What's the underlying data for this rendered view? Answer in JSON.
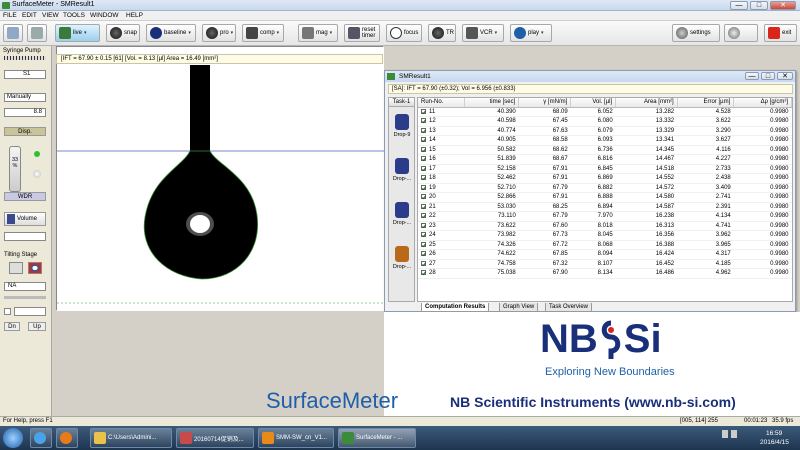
{
  "window": {
    "title": "SurfaceMeter - SMResult1",
    "min_label": "—",
    "max_label": "□",
    "close_label": "✕"
  },
  "menu": [
    "FILE",
    "EDIT",
    "VIEW",
    "TOOLS",
    "WINDOW",
    "HELP"
  ],
  "toolbar": {
    "live": "live",
    "snap": "snap",
    "baseline": "baseline",
    "pro": "pro",
    "comp": "comp",
    "mag": "mag",
    "reset_timer": "reset timer",
    "focus": "focus",
    "tr": "TR",
    "vcr": "VCR",
    "play": "play",
    "settings": "settings",
    "exit": "exit",
    "dropdown": "▾"
  },
  "left_panel": {
    "syringe_label": "Syringe Pump",
    "syringe_select": "S1",
    "mode_select": "Manually",
    "volume_value": "8.8",
    "dispense_label": "Disp.",
    "percent_value": "33",
    "percent_unit": "%",
    "wdr_label": "WDR",
    "volume_button": "Volume",
    "tilting_label": "Tilting Stage",
    "na_select": "NA",
    "dn_button": "Dn",
    "up_button": "Up"
  },
  "image": {
    "info": "[IFT = 67.90 ± 0.15 [61] [Vol. = 8.13 [µl]  Area = 16.49 [mm²]"
  },
  "result_window": {
    "title": "SMResult1",
    "formula": "[SA]: IFT = 67.90 (±0.32); Vol = 6.956 (±0.833)",
    "task_header": "Task-1",
    "tasks": [
      "Drop-9",
      "Drop-...",
      "Drop-..."
    ],
    "columns": [
      "Run-No.",
      "time [sec]",
      "γ [mN/m]",
      "Vol. [µl]",
      "Area [mm²]",
      "Error [µm]",
      "Δρ [g/cm³]"
    ],
    "rows": [
      [
        "11",
        "40.390",
        "68.09",
        "6.052",
        "13.282",
        "4.528",
        "0.9980"
      ],
      [
        "12",
        "40.598",
        "67.45",
        "6.080",
        "13.332",
        "3.622",
        "0.9980"
      ],
      [
        "13",
        "40.774",
        "67.63",
        "6.079",
        "13.329",
        "3.290",
        "0.9980"
      ],
      [
        "14",
        "40.905",
        "68.58",
        "6.093",
        "13.341",
        "3.627",
        "0.9980"
      ],
      [
        "15",
        "50.582",
        "68.62",
        "6.736",
        "14.345",
        "4.116",
        "0.9980"
      ],
      [
        "16",
        "51.839",
        "68.67",
        "6.816",
        "14.467",
        "4.227",
        "0.9980"
      ],
      [
        "17",
        "52.158",
        "67.91",
        "6.845",
        "14.518",
        "2.733",
        "0.9980"
      ],
      [
        "18",
        "52.462",
        "67.91",
        "6.869",
        "14.552",
        "2.438",
        "0.9980"
      ],
      [
        "19",
        "52.710",
        "67.79",
        "6.882",
        "14.572",
        "3.409",
        "0.9980"
      ],
      [
        "20",
        "52.866",
        "67.91",
        "6.888",
        "14.580",
        "2.741",
        "0.9980"
      ],
      [
        "21",
        "53.030",
        "68.25",
        "6.894",
        "14.587",
        "2.391",
        "0.9980"
      ],
      [
        "22",
        "73.110",
        "67.79",
        "7.970",
        "16.238",
        "4.134",
        "0.9980"
      ],
      [
        "23",
        "73.622",
        "67.60",
        "8.018",
        "16.313",
        "4.741",
        "0.9980"
      ],
      [
        "24",
        "73.982",
        "67.73",
        "8.045",
        "16.356",
        "3.962",
        "0.9980"
      ],
      [
        "25",
        "74.326",
        "67.72",
        "8.068",
        "16.388",
        "3.965",
        "0.9980"
      ],
      [
        "26",
        "74.622",
        "67.85",
        "8.094",
        "16.424",
        "4.317",
        "0.9980"
      ],
      [
        "27",
        "74.758",
        "67.32",
        "8.107",
        "16.452",
        "4.185",
        "0.9980"
      ],
      [
        "28",
        "75.038",
        "67.90",
        "8.134",
        "16.486",
        "4.962",
        "0.9980"
      ]
    ],
    "tabs": [
      "Computation Results",
      "Graph View",
      "Task Overview"
    ]
  },
  "brand": {
    "product": "SurfaceMeter",
    "logo_left": "NB",
    "logo_right": "Si",
    "tagline": "Exploring New Boundaries",
    "company": "NB Scientific Instruments (www.nb-si.com)"
  },
  "status": {
    "help": "For Help, press F1",
    "coords": "[005, 114] 255",
    "time": "00:01:23",
    "fps": "35.9 fps"
  },
  "taskbar": {
    "items": [
      "C:\\Users\\Admini...",
      "20160714促销及...",
      "SMM-SW_cn_V1...",
      "SurfaceMeter - ..."
    ],
    "clock_time": "16:59",
    "clock_date": "2016/4/15"
  },
  "colors": {
    "brand_blue": "#1f5fa8",
    "brand_navy": "#1a2f7a",
    "accent_red": "#d9261c"
  }
}
